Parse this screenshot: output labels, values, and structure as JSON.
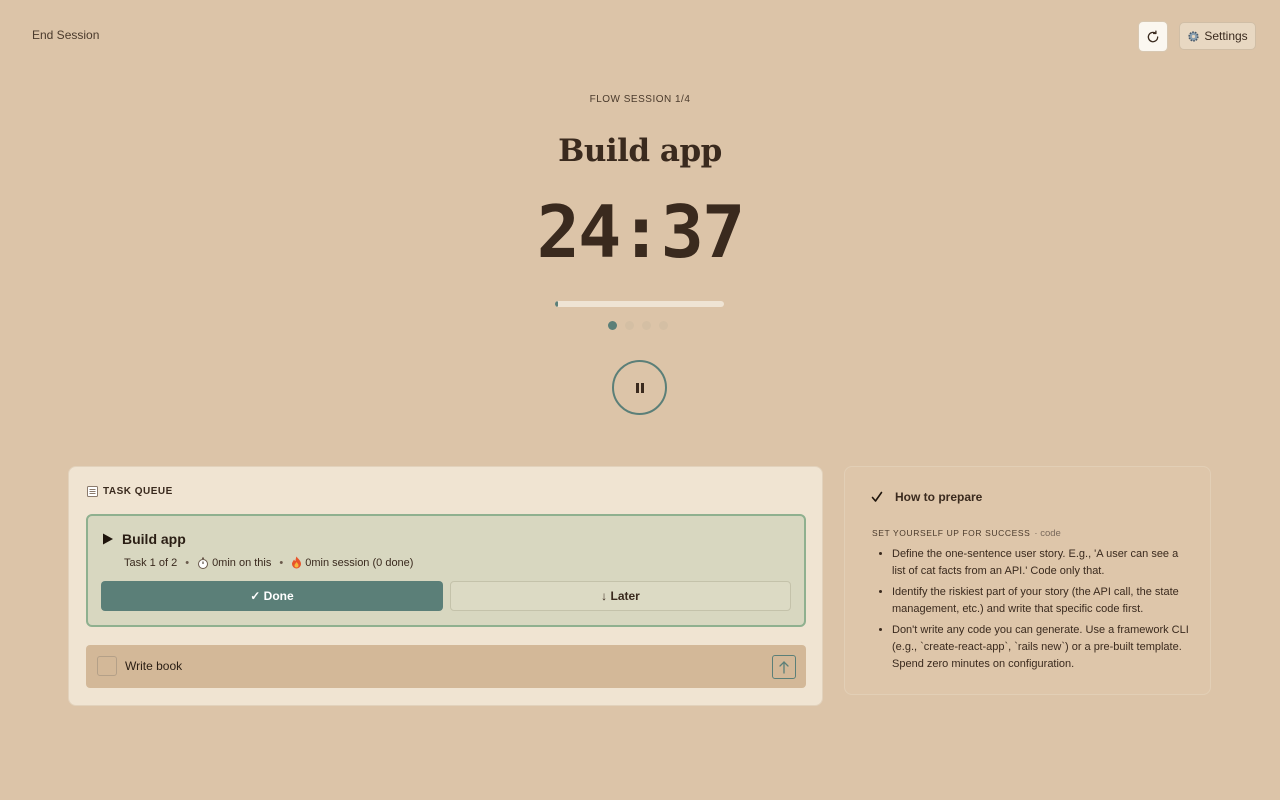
{
  "header": {
    "end_session_label": "End Session",
    "settings_label": "Settings"
  },
  "session": {
    "label": "FLOW SESSION 1/4",
    "title": "Build app",
    "timer": "24:37",
    "progress_fraction": 0.015,
    "total_dots": 4,
    "active_dot": 1
  },
  "queue": {
    "header": "TASK QUEUE",
    "active": {
      "title": "Build app",
      "task_position": "Task 1 of 2",
      "time_on_task": "0min on this",
      "session_time": "0min session (0 done)",
      "done_label": "✓ Done",
      "later_label": "↓ Later"
    },
    "items": [
      {
        "label": "Write book"
      }
    ]
  },
  "prep": {
    "title": "How to prepare",
    "subtitle": "SET YOURSELF UP FOR SUCCESS",
    "tag": "· code",
    "tips": [
      "Define the one-sentence user story. E.g., 'A user can see a list of cat facts from an API.' Code only that.",
      "Identify the riskiest part of your story (the API call, the state management, etc.) and write that specific code first.",
      "Don't write any code you can generate. Use a framework CLI (e.g., `create-react-app`, `rails new`) or a pre-built template. Spend zero minutes on configuration."
    ]
  },
  "colors": {
    "background": "#dcc4a8",
    "accent": "#5b7f78",
    "active_card_border": "#8fb08f"
  },
  "icons": {
    "refresh": "refresh-icon",
    "settings": "gear-icon",
    "pause": "pause-icon",
    "queue": "checklist-icon",
    "play": "play-icon",
    "timer": "stopwatch-icon",
    "fire": "fire-icon",
    "up": "arrow-up-icon",
    "check": "check-icon"
  }
}
